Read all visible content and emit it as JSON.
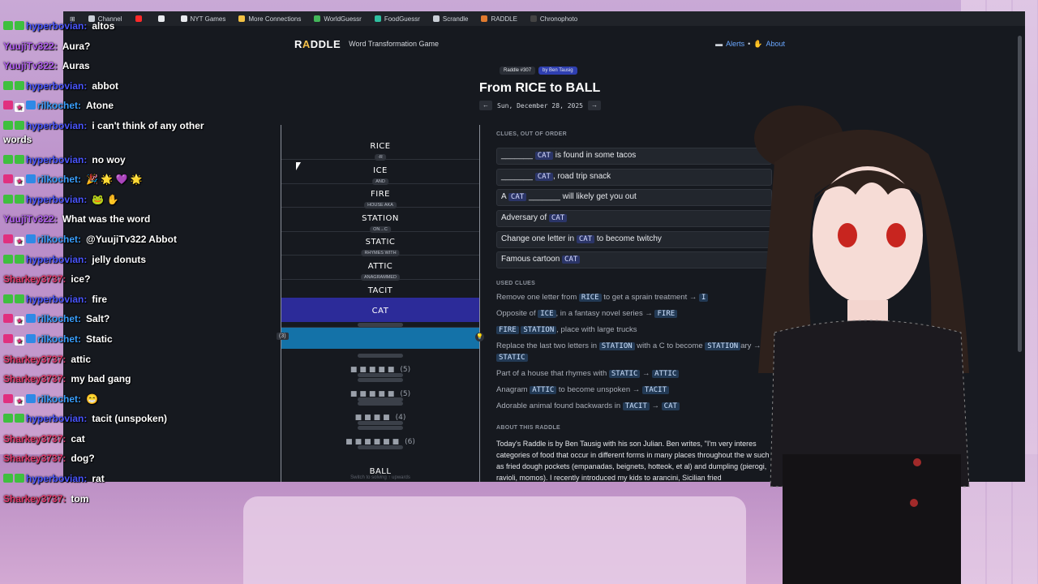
{
  "bookmarks": [
    {
      "label": "Channel",
      "icon": "folder-icon",
      "color": "#c9ced6"
    },
    {
      "label": "",
      "icon": "youtube-icon",
      "color": "#ff2a2a"
    },
    {
      "label": "",
      "icon": "x-icon",
      "color": "#e8eaee"
    },
    {
      "label": "NYT Games",
      "icon": "nyt-icon",
      "color": "#e8eaee"
    },
    {
      "label": "More Connections",
      "icon": "grid-icon",
      "color": "#f2c144"
    },
    {
      "label": "WorldGuessr",
      "icon": "globe-icon",
      "color": "#43b55a"
    },
    {
      "label": "FoodGuessr",
      "icon": "food-icon",
      "color": "#2fbfa0"
    },
    {
      "label": "Scrandle",
      "icon": "scrandle-icon",
      "color": "#c9ced6"
    },
    {
      "label": "RADDLE",
      "icon": "raddle-icon",
      "color": "#e07a2f"
    },
    {
      "label": "Chronophoto",
      "icon": "chronophoto-icon",
      "color": "#444"
    }
  ],
  "site": {
    "logo_pre": "R",
    "logo_mid": "A",
    "logo_post": "DDLE",
    "tagline": "Word Transformation Game",
    "alerts": "Alerts",
    "about": "About",
    "bullet": "•"
  },
  "puzzle": {
    "number_badge": "Raddle #307",
    "author_badge": "by Ben Tausig",
    "title": "From RICE to BALL",
    "prev": "←",
    "next": "→",
    "date": "Sun, December 28, 2025"
  },
  "ladder": {
    "rungs": [
      {
        "word": "RICE",
        "connector": "-R"
      },
      {
        "word": "ICE",
        "connector": "AND"
      },
      {
        "word": "FIRE",
        "connector": "HOUSE AKA"
      },
      {
        "word": "STATION",
        "connector": "ON→C"
      },
      {
        "word": "STATIC",
        "connector": "RHYMES WITH"
      },
      {
        "word": "ATTIC",
        "connector": "ANAGRAMMED"
      },
      {
        "word": "TACIT",
        "connector": "PARTIALLY BACKWARDS IS"
      },
      {
        "word": "CAT",
        "connector": ""
      }
    ],
    "active_num": "(3)",
    "hint_icon": "💡",
    "blanks": [
      {
        "dots": "■■■■■",
        "count": "(5)"
      },
      {
        "dots": "■■■■■",
        "count": "(5)"
      },
      {
        "dots": "■■■■",
        "count": "(4)"
      },
      {
        "dots": "■■■■■■",
        "count": "(6)"
      }
    ],
    "final_word": "BALL",
    "switch_note": "Switch to solving ↑ upwards"
  },
  "clues": {
    "heading": "CLUES, OUT OF ORDER",
    "items": [
      {
        "pre": "_______ ",
        "hl": "CAT",
        "post": " is found in some tacos"
      },
      {
        "pre": "_______ ",
        "hl": "CAT",
        "post": ", road trip snack"
      },
      {
        "pre": "A ",
        "hl": "CAT",
        "post": " _______ will likely get you out"
      },
      {
        "pre": "Adversary of ",
        "hl": "CAT",
        "post": ""
      },
      {
        "pre": "Change one letter in ",
        "hl": "CAT",
        "post": " to become twitchy"
      },
      {
        "pre": "Famous cartoon ",
        "hl": "CAT",
        "post": ""
      }
    ]
  },
  "used_clues": {
    "heading": "USED CLUES",
    "items": [
      {
        "a": "Remove one letter from ",
        "w1": "RICE",
        "b": " to get a sprain treatment → ",
        "w2": "I",
        "c": ""
      },
      {
        "a": "Opposite of ",
        "w1": "ICE",
        "b": ", in a fantasy novel series → ",
        "w2": "FIRE",
        "c": ""
      },
      {
        "a": "",
        "w1": "FIRE",
        "b": " ",
        "w2": "STATION",
        "c": ", place with large trucks"
      },
      {
        "a": "Replace the last two letters in ",
        "w1": "STATION",
        "b": " with a C to become ",
        "w2": "STATION",
        "c": "ary →"
      },
      {
        "a": "Part of a house that rhymes with ",
        "w1": "STATIC",
        "b": " → ",
        "w2": "ATTIC",
        "c": ""
      },
      {
        "a": "Anagram ",
        "w1": "ATTIC",
        "b": " to become unspoken → ",
        "w2": "TACIT",
        "c": ""
      },
      {
        "a": "Adorable animal found backwards in ",
        "w1": "TACIT",
        "b": " → ",
        "w2": "CAT",
        "c": ""
      }
    ],
    "extra": "STATIC"
  },
  "about": {
    "heading": "ABOUT THIS RADDLE",
    "text": "Today's Raddle is by Ben Tausig with his son Julian. Ben writes, \"I'm very interes categories of food that occur in different forms in many places throughout the w such as fried dough pockets (empanadas, beignets, hotteok, et al) and dumpling (pierogi, ravioli, momos). I recently introduced my kids to arancini, Sicilian fried"
  },
  "chat": [
    {
      "badges": [
        "green",
        "green"
      ],
      "user": "hyperbovian:",
      "ucls": "u-hyper",
      "text": "altos"
    },
    {
      "badges": [],
      "user": "YuujiTv322:",
      "ucls": "u-yuu",
      "text": "Aura?"
    },
    {
      "badges": [],
      "user": "YuujiTv322:",
      "ucls": "u-yuu",
      "text": "Auras"
    },
    {
      "badges": [
        "green",
        "green"
      ],
      "user": "hyperbovian:",
      "ucls": "u-hyper",
      "text": "abbot"
    },
    {
      "badges": [
        "pink",
        "star",
        "blue"
      ],
      "user": "rilkochet:",
      "ucls": "u-ril",
      "text": "Atone"
    },
    {
      "badges": [
        "green",
        "green"
      ],
      "user": "hyperbovian:",
      "ucls": "u-hyper",
      "text": "i can't think of any other words"
    },
    {
      "badges": [
        "green",
        "green"
      ],
      "user": "hyperbovian:",
      "ucls": "u-hyper",
      "text": "no woy"
    },
    {
      "badges": [
        "pink",
        "star",
        "blue"
      ],
      "user": "rilkochet:",
      "ucls": "u-ril",
      "text": "🎉 🌟 💜 🌟"
    },
    {
      "badges": [
        "green",
        "green"
      ],
      "user": "hyperbovian:",
      "ucls": "u-hyper",
      "text": "🐸 ✋"
    },
    {
      "badges": [],
      "user": "YuujiTv322:",
      "ucls": "u-yuu",
      "text": "What was the word"
    },
    {
      "badges": [
        "pink",
        "star",
        "blue"
      ],
      "user": "rilkochet:",
      "ucls": "u-ril",
      "text": "@YuujiTv322 Abbot"
    },
    {
      "badges": [
        "green",
        "green"
      ],
      "user": "hyperbovian:",
      "ucls": "u-hyper",
      "text": "jelly donuts"
    },
    {
      "badges": [],
      "user": "Sharkey3737:",
      "ucls": "u-shark",
      "text": "ice?"
    },
    {
      "badges": [
        "green",
        "green"
      ],
      "user": "hyperbovian:",
      "ucls": "u-hyper",
      "text": "fire"
    },
    {
      "badges": [
        "pink",
        "star",
        "blue"
      ],
      "user": "rilkochet:",
      "ucls": "u-ril",
      "text": "Salt?"
    },
    {
      "badges": [
        "pink",
        "star",
        "blue"
      ],
      "user": "rilkochet:",
      "ucls": "u-ril",
      "text": "Static"
    },
    {
      "badges": [],
      "user": "Sharkey3737:",
      "ucls": "u-shark",
      "text": "attic"
    },
    {
      "badges": [],
      "user": "Sharkey3737:",
      "ucls": "u-shark",
      "text": "my bad gang"
    },
    {
      "badges": [
        "pink",
        "star",
        "blue"
      ],
      "user": "rilkochet:",
      "ucls": "u-ril",
      "text": "😁"
    },
    {
      "badges": [
        "green",
        "green"
      ],
      "user": "hyperbovian:",
      "ucls": "u-hyper",
      "text": "tacit (unspoken)"
    },
    {
      "badges": [],
      "user": "Sharkey3737:",
      "ucls": "u-shark",
      "text": "cat"
    },
    {
      "badges": [],
      "user": "Sharkey3737:",
      "ucls": "u-shark",
      "text": "dog?"
    },
    {
      "badges": [
        "green",
        "green"
      ],
      "user": "hyperbovian:",
      "ucls": "u-hyper",
      "text": "rat"
    },
    {
      "badges": [],
      "user": "Sharkey3737:",
      "ucls": "u-shark",
      "text": "tom"
    }
  ]
}
